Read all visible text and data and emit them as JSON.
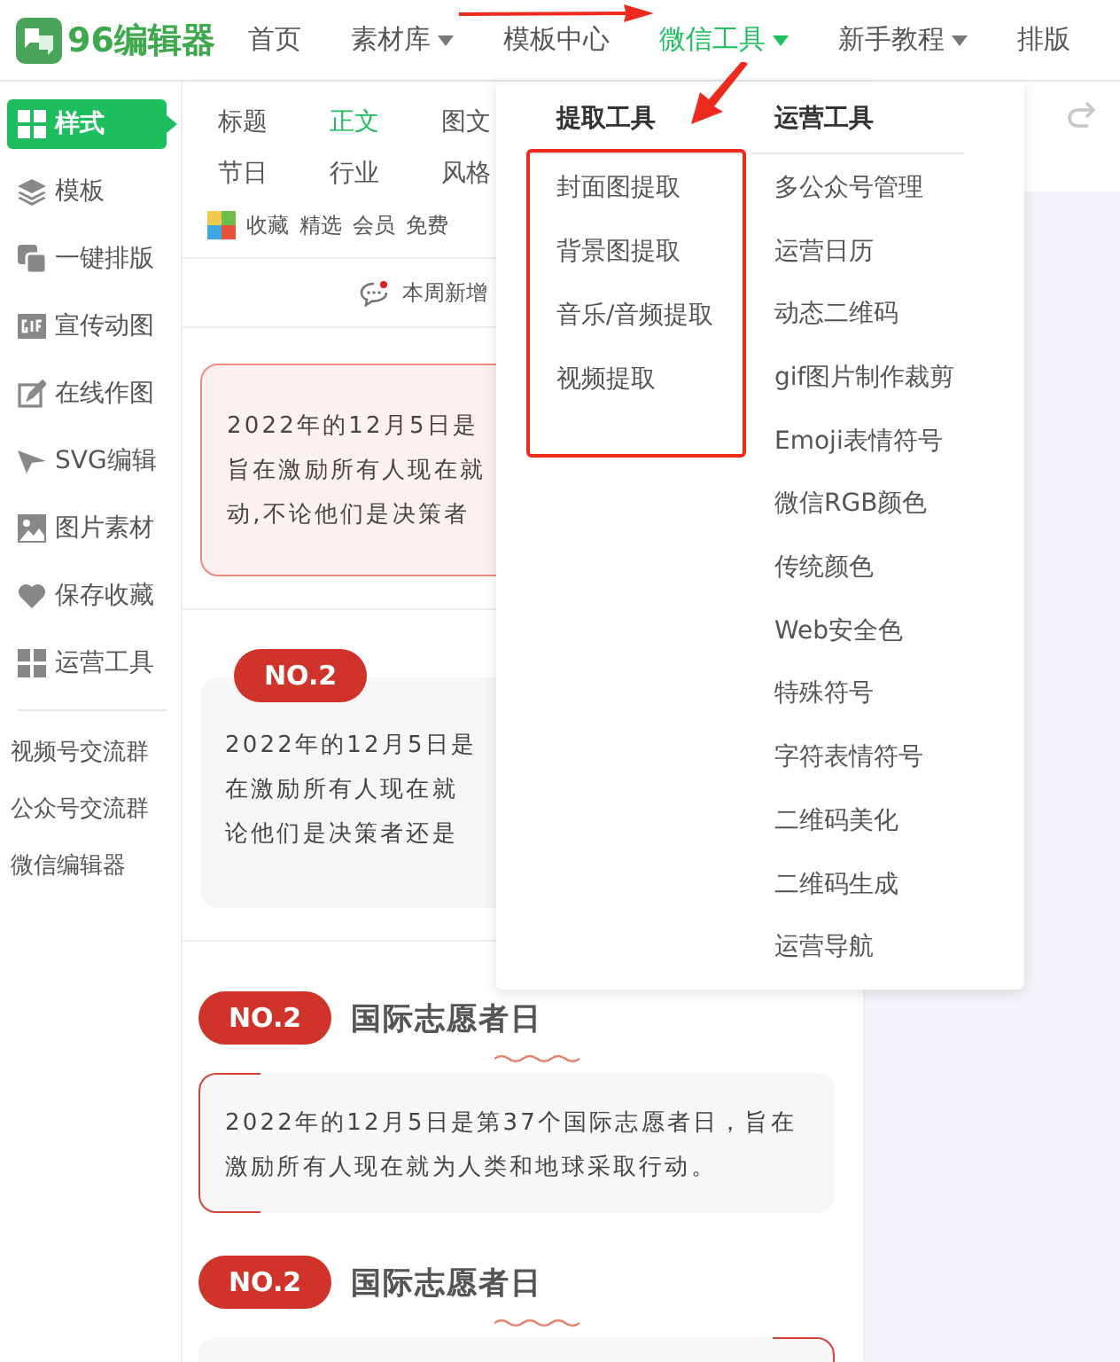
{
  "logo": {
    "text": "96编辑器"
  },
  "nav": [
    {
      "label": "首页",
      "selected": false,
      "has_menu": false
    },
    {
      "label": "素材库",
      "selected": false,
      "has_menu": true
    },
    {
      "label": "模板中心",
      "selected": false,
      "has_menu": false
    },
    {
      "label": "微信工具",
      "selected": true,
      "has_menu": true
    },
    {
      "label": "新手教程",
      "selected": false,
      "has_menu": true
    },
    {
      "label": "排版",
      "selected": false,
      "has_menu": false
    }
  ],
  "sidebar": {
    "items": [
      {
        "label": "样式",
        "selected": true
      },
      {
        "label": "模板",
        "selected": false
      },
      {
        "label": "一键排版",
        "selected": false
      },
      {
        "label": "宣传动图",
        "selected": false
      },
      {
        "label": "在线作图",
        "selected": false
      },
      {
        "label": "SVG编辑",
        "selected": false
      },
      {
        "label": "图片素材",
        "selected": false
      },
      {
        "label": "保存收藏",
        "selected": false
      },
      {
        "label": "运营工具",
        "selected": false
      }
    ],
    "links": [
      "视频号交流群",
      "公众号交流群",
      "微信编辑器"
    ]
  },
  "categories": [
    [
      {
        "label": "标题",
        "selected": false
      },
      {
        "label": "正文",
        "selected": true
      },
      {
        "label": "图文",
        "selected": false
      }
    ],
    [
      {
        "label": "节日",
        "selected": false
      },
      {
        "label": "行业",
        "selected": false
      },
      {
        "label": "风格",
        "selected": false
      }
    ]
  ],
  "filters": [
    "收藏",
    "精选",
    "会员",
    "免费"
  ],
  "notice": "本周新增",
  "cards": [
    {
      "kind": "pink",
      "lines": [
        "2022年的12月5日是",
        "旨在激励所有人现在就",
        "动,不论他们是决策者"
      ]
    },
    {
      "kind": "badge",
      "badge": "NO.2",
      "lines": [
        "2022年的12月5日是",
        "在激励所有人现在就",
        "论他们是决策者还是"
      ]
    },
    {
      "kind": "titled",
      "badge": "NO.2",
      "title": "国际志愿者日",
      "text": "2022年的12月5日是第37个国际志愿者日，旨在激励所有人现在就为人类和地球采取行动。"
    },
    {
      "kind": "titled",
      "badge": "NO.2",
      "title": "国际志愿者日"
    }
  ],
  "dropdown": {
    "columns": [
      {
        "title": "提取工具",
        "items": [
          "封面图提取",
          "背景图提取",
          "音乐/音频提取",
          "视频提取"
        ]
      },
      {
        "title": "运营工具",
        "items": [
          "多公众号管理",
          "运营日历",
          "动态二维码",
          "gif图片制作裁剪",
          "Emoji表情符号",
          "微信RGB颜色",
          "传统颜色",
          "Web安全色",
          "特殊符号",
          "字符表情符号",
          "二维码美化",
          "二维码生成",
          "运营导航"
        ]
      }
    ]
  }
}
